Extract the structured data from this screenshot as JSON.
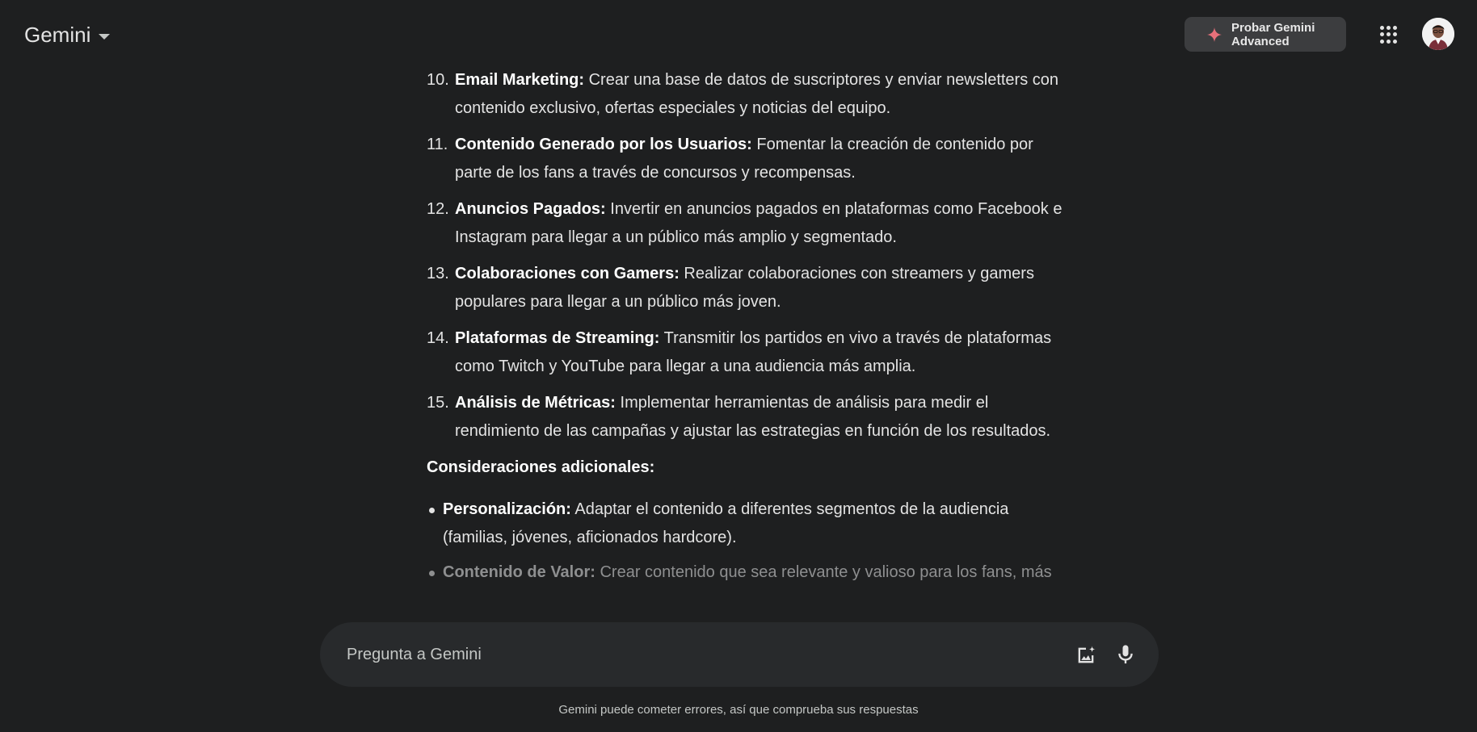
{
  "app": {
    "title": "Gemini"
  },
  "header": {
    "upgrade_label": "Probar Gemini Advanced",
    "icons": [
      "sparkle-icon",
      "apps-grid-icon",
      "avatar"
    ]
  },
  "response": {
    "numbered_items": [
      {
        "num": "10.",
        "title": "Email Marketing:",
        "text": " Crear una base de datos de suscriptores y enviar newsletters con contenido exclusivo, ofertas especiales y noticias del equipo."
      },
      {
        "num": "11.",
        "title": "Contenido Generado por los Usuarios:",
        "text": " Fomentar la creación de contenido por parte de los fans a través de concursos y recompensas."
      },
      {
        "num": "12.",
        "title": "Anuncios Pagados:",
        "text": " Invertir en anuncios pagados en plataformas como Facebook e Instagram para llegar a un público más amplio y segmentado."
      },
      {
        "num": "13.",
        "title": "Colaboraciones con Gamers:",
        "text": " Realizar colaboraciones con streamers y gamers populares para llegar a un público más joven."
      },
      {
        "num": "14.",
        "title": "Plataformas de Streaming:",
        "text": " Transmitir los partidos en vivo a través de plataformas como Twitch y YouTube para llegar a una audiencia más amplia."
      },
      {
        "num": "15.",
        "title": "Análisis de Métricas:",
        "text": " Implementar herramientas de análisis para medir el rendimiento de las campañas y ajustar las estrategias en función de los resultados."
      }
    ],
    "section_title": "Consideraciones adicionales:",
    "bullet_items": [
      {
        "title": "Personalización:",
        "text": " Adaptar el contenido a diferentes segmentos de la audiencia (familias, jóvenes, aficionados hardcore)."
      },
      {
        "title": "Contenido de Valor:",
        "text": " Crear contenido que sea relevante y valioso para los fans, más"
      }
    ]
  },
  "prompt": {
    "placeholder": "Pregunta a Gemini",
    "value": ""
  },
  "footer": {
    "disclaimer": "Gemini puede cometer errores, así que comprueba sus respuestas"
  },
  "colors": {
    "background": "#1e1f20",
    "prompt_bar": "#282a2c",
    "upgrade_button": "#3c3d3f",
    "sparkle": "#e8707a"
  }
}
